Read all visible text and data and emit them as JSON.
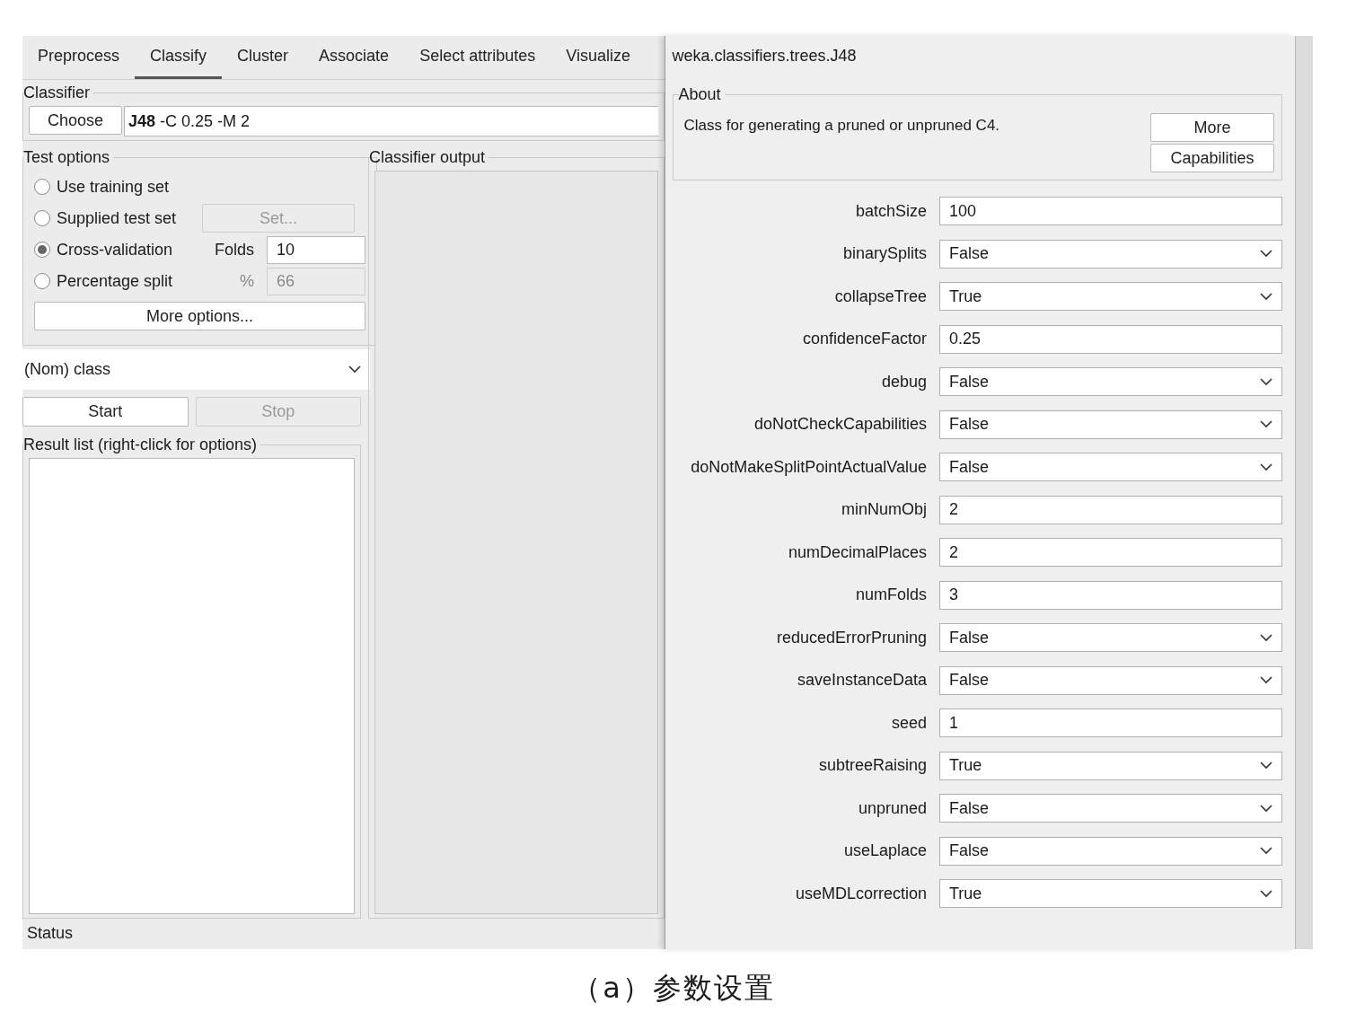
{
  "tabs": [
    {
      "label": "Preprocess",
      "selected": false
    },
    {
      "label": "Classify",
      "selected": true
    },
    {
      "label": "Cluster",
      "selected": false
    },
    {
      "label": "Associate",
      "selected": false
    },
    {
      "label": "Select attributes",
      "selected": false
    },
    {
      "label": "Visualize",
      "selected": false
    }
  ],
  "classifier": {
    "heading": "Classifier",
    "button": "Choose",
    "value": "**J48** -C 0.25 -M 2"
  },
  "test_options": {
    "heading": "Test options",
    "options": [
      {
        "label": "Use training set",
        "selected": false,
        "kind": "plain"
      },
      {
        "label": "Supplied test set",
        "selected": false,
        "kind": "button",
        "control": "Set...",
        "disabled": true
      },
      {
        "label": "Cross-validation",
        "selected": true,
        "kind": "field",
        "field_label": "Folds",
        "value": "10",
        "disabled": false
      },
      {
        "label": "Percentage split",
        "selected": false,
        "kind": "field",
        "field_label": "%",
        "value": "66",
        "disabled": true
      }
    ],
    "more_options": "More options..."
  },
  "class_select": "(Nom) class",
  "run_buttons": [
    {
      "label": "Start",
      "disabled": false
    },
    {
      "label": "Stop",
      "disabled": true
    }
  ],
  "result_list": {
    "heading": "Result list (right-click for options)"
  },
  "output": {
    "heading": "Classifier output"
  },
  "status": {
    "heading": "Status"
  },
  "dialog": {
    "title": "weka.classifiers.trees.J48",
    "about_heading": "About",
    "about_text": "Class for generating a pruned or unpruned C4.",
    "buttons": [
      "More",
      "Capabilities"
    ],
    "params": [
      {
        "name": "batchSize",
        "kind": "text",
        "value": "100"
      },
      {
        "name": "binarySplits",
        "kind": "dropdown",
        "value": "False"
      },
      {
        "name": "collapseTree",
        "kind": "dropdown",
        "value": "True"
      },
      {
        "name": "confidenceFactor",
        "kind": "text",
        "value": "0.25"
      },
      {
        "name": "debug",
        "kind": "dropdown",
        "value": "False"
      },
      {
        "name": "doNotCheckCapabilities",
        "kind": "dropdown",
        "value": "False"
      },
      {
        "name": "doNotMakeSplitPointActualValue",
        "kind": "dropdown",
        "value": "False"
      },
      {
        "name": "minNumObj",
        "kind": "text",
        "value": "2"
      },
      {
        "name": "numDecimalPlaces",
        "kind": "text",
        "value": "2"
      },
      {
        "name": "numFolds",
        "kind": "text",
        "value": "3"
      },
      {
        "name": "reducedErrorPruning",
        "kind": "dropdown",
        "value": "False"
      },
      {
        "name": "saveInstanceData",
        "kind": "dropdown",
        "value": "False"
      },
      {
        "name": "seed",
        "kind": "text",
        "value": "1"
      },
      {
        "name": "subtreeRaising",
        "kind": "dropdown",
        "value": "True"
      },
      {
        "name": "unpruned",
        "kind": "dropdown",
        "value": "False"
      },
      {
        "name": "useLaplace",
        "kind": "dropdown",
        "value": "False"
      },
      {
        "name": "useMDLcorrection",
        "kind": "dropdown",
        "value": "True"
      }
    ]
  },
  "caption": "（a）参数设置"
}
